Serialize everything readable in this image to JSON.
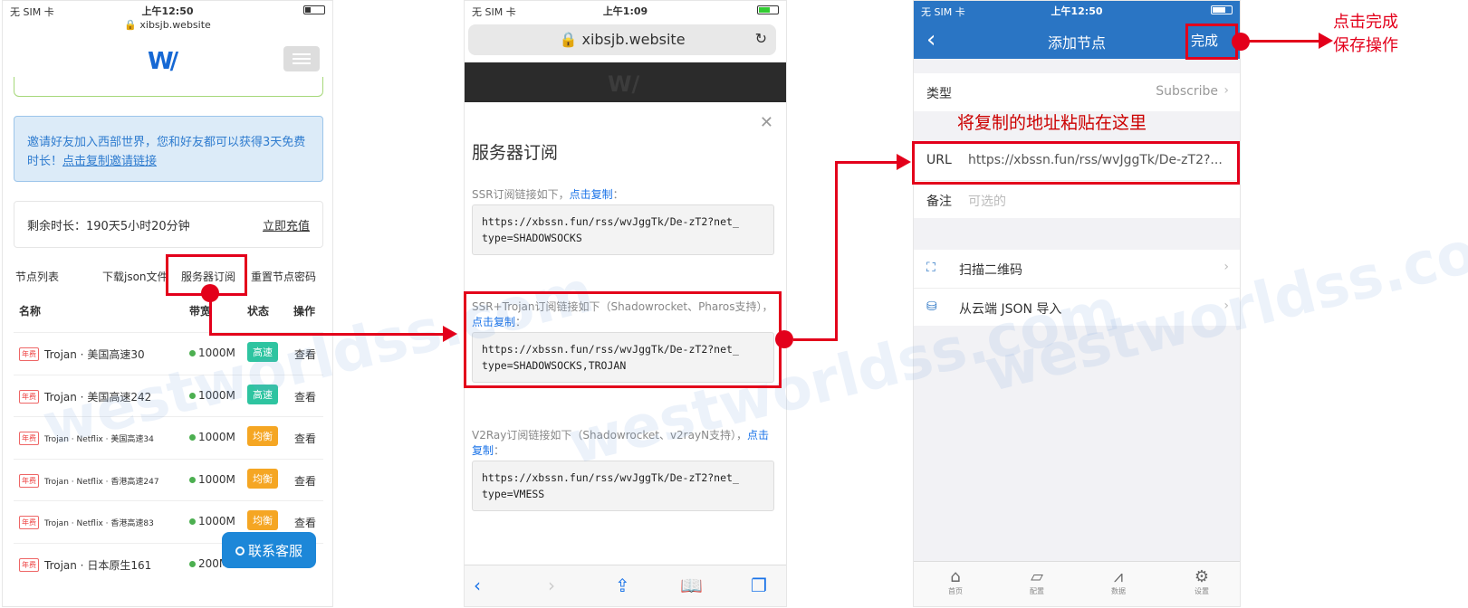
{
  "phone1": {
    "carrier": "无 SIM 卡",
    "time": "上午12:50",
    "url": "xibsjb.website",
    "logo": "W",
    "invite_text": "邀请好友加入西部世界，您和好友都可以获得3天免费时长！",
    "invite_link": "点击复制邀请链接",
    "remaining_label": "剩余时长：190天5小时20分钟",
    "recharge": "立即充值",
    "tabs": [
      "节点列表",
      "下载json文件",
      "服务器订阅",
      "重置节点密码"
    ],
    "headers": [
      "名称",
      "带宽",
      "状态",
      "操作"
    ],
    "rows": [
      {
        "tag": "年费",
        "name": "Trojan · 美国高速30",
        "small": false,
        "bw": "1000M",
        "status": "高速",
        "color": "#2ec4a0",
        "op": "查看"
      },
      {
        "tag": "年费",
        "name": "Trojan · 美国高速242",
        "small": false,
        "bw": "1000M",
        "status": "高速",
        "color": "#2ec4a0",
        "op": "查看"
      },
      {
        "tag": "年费",
        "name": "Trojan · Netflix · 美国高速34",
        "small": true,
        "bw": "1000M",
        "status": "均衡",
        "color": "#f5a623",
        "op": "查看"
      },
      {
        "tag": "年费",
        "name": "Trojan · Netflix · 香港高速247",
        "small": true,
        "bw": "1000M",
        "status": "均衡",
        "color": "#f5a623",
        "op": "查看"
      },
      {
        "tag": "年费",
        "name": "Trojan · Netflix · 香港高速83",
        "small": true,
        "bw": "1000M",
        "status": "均衡",
        "color": "#f5a623",
        "op": "查看"
      },
      {
        "tag": "年费",
        "name": "Trojan · 日本原生161",
        "small": false,
        "bw": "200M",
        "status": "",
        "color": "#f5a623",
        "op": ""
      }
    ],
    "customer_service": "联系客服"
  },
  "phone2": {
    "carrier": "无 SIM 卡",
    "time": "上午1:09",
    "url": "xibsjb.website",
    "title": "服务器订阅",
    "sections": [
      {
        "desc": "SSR订阅链接如下，",
        "copy": "点击复制",
        "suffix": "：",
        "code": "https://xbssn.fun/rss/wvJggTk/De-zT2?net_\ntype=SHADOWSOCKS"
      },
      {
        "desc": "SSR+Trojan订阅链接如下（Shadowrocket、Pharos支持），",
        "copy": "点击复制",
        "suffix": "：",
        "code": "https://xbssn.fun/rss/wvJggTk/De-zT2?net_\ntype=SHADOWSOCKS,TROJAN"
      },
      {
        "desc": "V2Ray订阅链接如下（Shadowrocket、v2rayN支持），",
        "copy": "点击复制",
        "suffix": "：",
        "code": "https://xbssn.fun/rss/wvJggTk/De-zT2?net_\ntype=VMESS"
      }
    ]
  },
  "phone3": {
    "carrier": "无 SIM 卡",
    "time": "上午12:50",
    "title": "添加节点",
    "done": "完成",
    "type_label": "类型",
    "type_value": "Subscribe",
    "note": "将复制的地址粘贴在这里",
    "url_label": "URL",
    "url_value": "https://xbssn.fun/rss/wvJggTk/De-zT2?...",
    "remark_label": "备注",
    "remark_placeholder": "可选的",
    "scan": "扫描二维码",
    "import": "从云端 JSON 导入",
    "tabs": [
      "首页",
      "配置",
      "数据",
      "设置"
    ]
  },
  "annotation": {
    "line1": "点击完成",
    "line2": "保存操作"
  },
  "watermark": "westworldss.com"
}
